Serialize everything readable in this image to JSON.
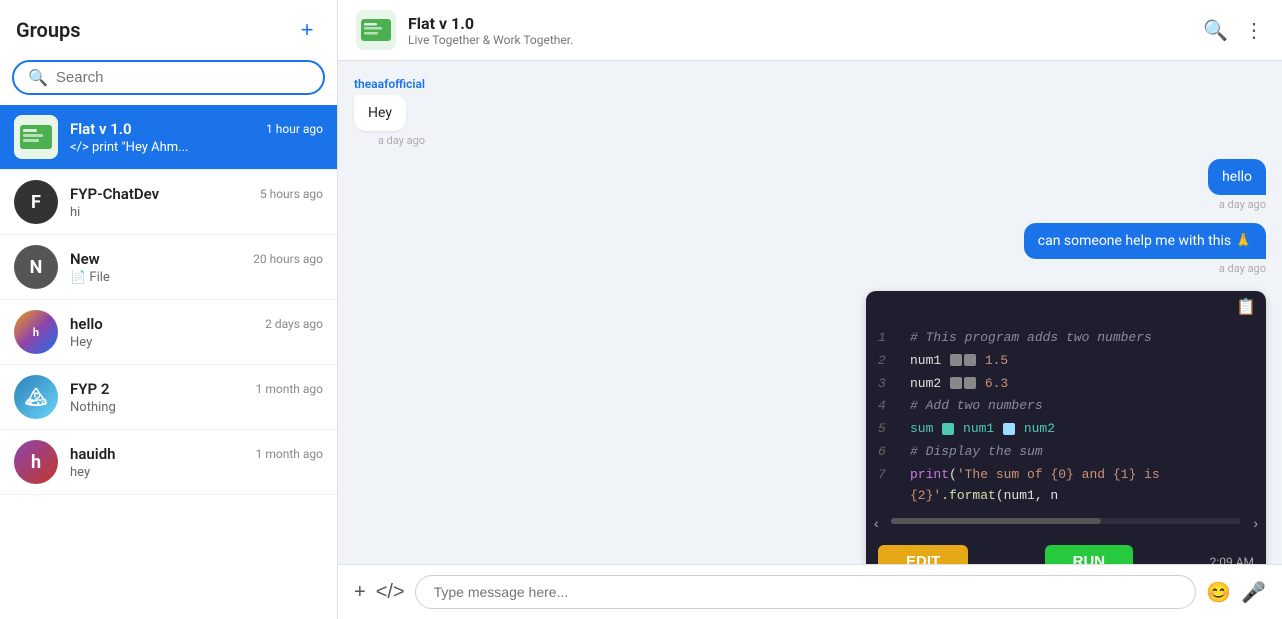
{
  "sidebar": {
    "title": "Groups",
    "add_btn": "+",
    "search_placeholder": "Search",
    "groups": [
      {
        "id": "flat-v1",
        "name": "Flat v 1.0",
        "time": "1 hour ago",
        "last_msg": "</> print \"Hey Ahm...",
        "avatar_type": "flatv",
        "active": true
      },
      {
        "id": "fyp-chatdev",
        "name": "FYP-ChatDev",
        "time": "5 hours ago",
        "last_msg": "hi",
        "avatar_type": "dark",
        "active": false
      },
      {
        "id": "new",
        "name": "New",
        "time": "20 hours ago",
        "last_msg": "📄 File",
        "avatar_type": "dark-circle",
        "active": false
      },
      {
        "id": "hello",
        "name": "hello",
        "time": "2 days ago",
        "last_msg": "Hey",
        "avatar_type": "multi",
        "active": false
      },
      {
        "id": "fyp2",
        "name": "FYP 2",
        "time": "1 month ago",
        "last_msg": "Nothing",
        "avatar_type": "mountain",
        "active": false
      },
      {
        "id": "hauidh",
        "name": "hauidh",
        "time": "1 month ago",
        "last_msg": "hey",
        "avatar_type": "purple",
        "active": false
      }
    ]
  },
  "chat": {
    "title": "Flat v 1.0",
    "subtitle": "Live Together & Work Together.",
    "search_icon": "🔍",
    "more_icon": "⋮",
    "messages": [
      {
        "type": "other",
        "sender": "theaafofficial",
        "text": "Hey",
        "time": "a day ago"
      },
      {
        "type": "self",
        "text": "hello",
        "time": "a day ago"
      },
      {
        "type": "self",
        "text": "can someone help me with this 🙏",
        "time": "a day ago"
      }
    ],
    "code_block": {
      "lines": [
        {
          "num": 1,
          "content": "# This program adds two numbers",
          "type": "comment"
        },
        {
          "num": 2,
          "content": "num1",
          "suffix": "1.5",
          "type": "assign"
        },
        {
          "num": 3,
          "content": "num2",
          "suffix": "6.3",
          "type": "assign"
        },
        {
          "num": 4,
          "content": "# Add two numbers",
          "type": "comment"
        },
        {
          "num": 5,
          "content": "sum",
          "suffix": "num1",
          "suffix2": "num2",
          "type": "sum"
        },
        {
          "num": 6,
          "content": "# Display the sum",
          "type": "comment"
        },
        {
          "num": 7,
          "content": "print('The sum of {0} and {1} is {2}'.format(num1, n",
          "type": "print"
        }
      ],
      "edit_label": "EDIT",
      "run_label": "RUN",
      "time": "2:09 AM"
    },
    "input_placeholder": "Type message here...",
    "add_icon": "+",
    "code_icon": "</>",
    "emoji_icon": "😊",
    "mic_icon": "🎤"
  }
}
